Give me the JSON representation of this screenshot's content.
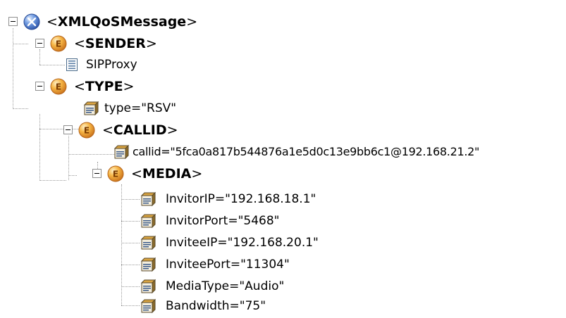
{
  "tree": {
    "root": {
      "lt": "<",
      "tag": "XMLQoSMessage",
      "gt": ">",
      "icon": "root-node-icon",
      "children": {
        "sender": {
          "lt": "<",
          "tag": "SENDER",
          "gt": ">",
          "icon": "element-icon",
          "text_node": {
            "value": "SIPProxy",
            "icon": "text-node-icon"
          }
        },
        "type": {
          "lt": "<",
          "tag": "TYPE",
          "gt": ">",
          "icon": "element-icon",
          "attribute": {
            "text": "type=\"RSV\"",
            "icon": "attribute-icon"
          },
          "callid": {
            "lt": "<",
            "tag": "CALLID",
            "gt": ">",
            "icon": "element-icon",
            "attribute": {
              "text": "callid=\"5fca0a817b544876a1e5d0c13e9bb6c1@192.168.21.2\"",
              "icon": "attribute-icon"
            },
            "media": {
              "lt": "<",
              "tag": "MEDIA",
              "gt": ">",
              "icon": "element-icon",
              "attributes": [
                {
                  "text": "InvitorIP=\"192.168.18.1\""
                },
                {
                  "text": "InvitorPort=\"5468\""
                },
                {
                  "text": "InviteeIP=\"192.168.20.1\""
                },
                {
                  "text": "InviteePort=\"11304\""
                },
                {
                  "text": "MediaType=\"Audio\""
                },
                {
                  "text": "Bandwidth=\"75\""
                }
              ]
            }
          }
        }
      }
    }
  },
  "colors": {
    "element_icon": "#f0a030",
    "root_icon": "#4f7fd0",
    "tree_lines": "#9a9a9a"
  }
}
